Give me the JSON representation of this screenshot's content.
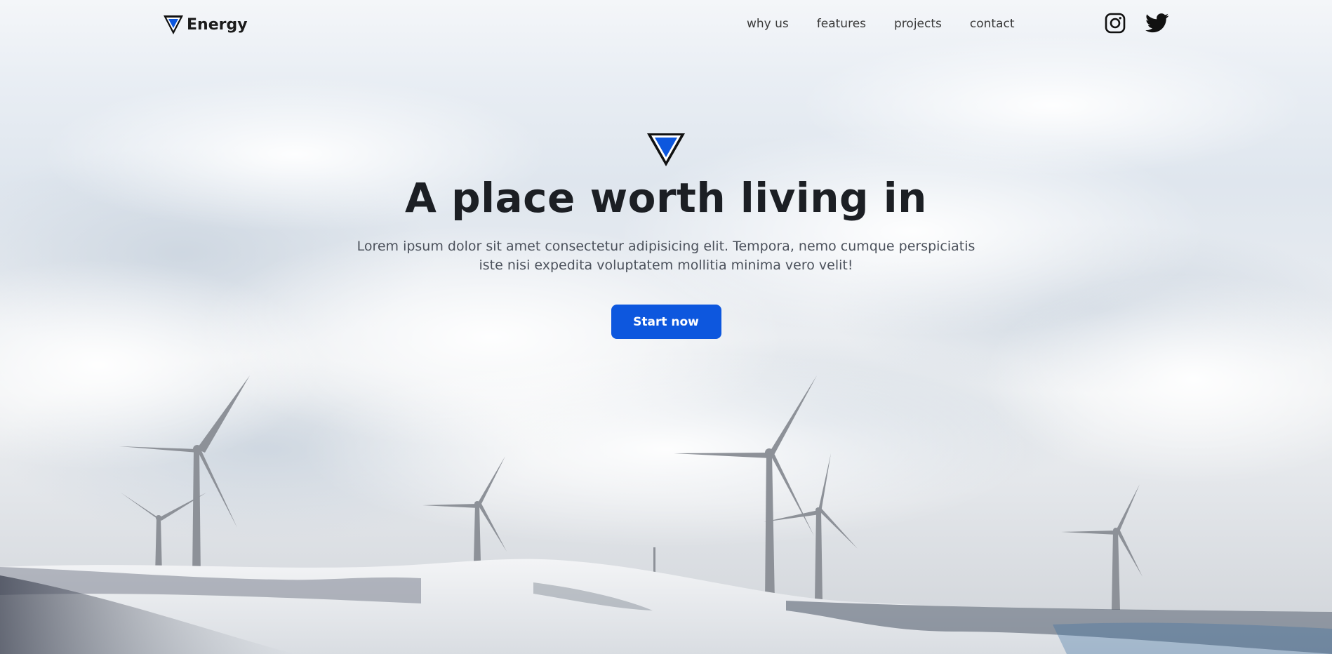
{
  "brand": {
    "name": "Energy",
    "logo_icon": "inverted-triangle-icon",
    "accent_color": "#0d57de"
  },
  "nav": {
    "items": [
      {
        "label": "why us"
      },
      {
        "label": "features"
      },
      {
        "label": "projects"
      },
      {
        "label": "contact"
      }
    ]
  },
  "social": {
    "icons": [
      "instagram-icon",
      "twitter-icon"
    ]
  },
  "hero": {
    "logo_icon": "inverted-triangle-icon",
    "title": "A place worth living in",
    "subtitle": "Lorem ipsum dolor sit amet consectetur adipisicing elit. Tempora, nemo cumque perspiciatis iste nisi expedita voluptatem mollitia minima vero velit!",
    "cta_label": "Start now",
    "cta_color": "#0d57de",
    "background": "wind-turbines-on-snowy-hills-image"
  }
}
